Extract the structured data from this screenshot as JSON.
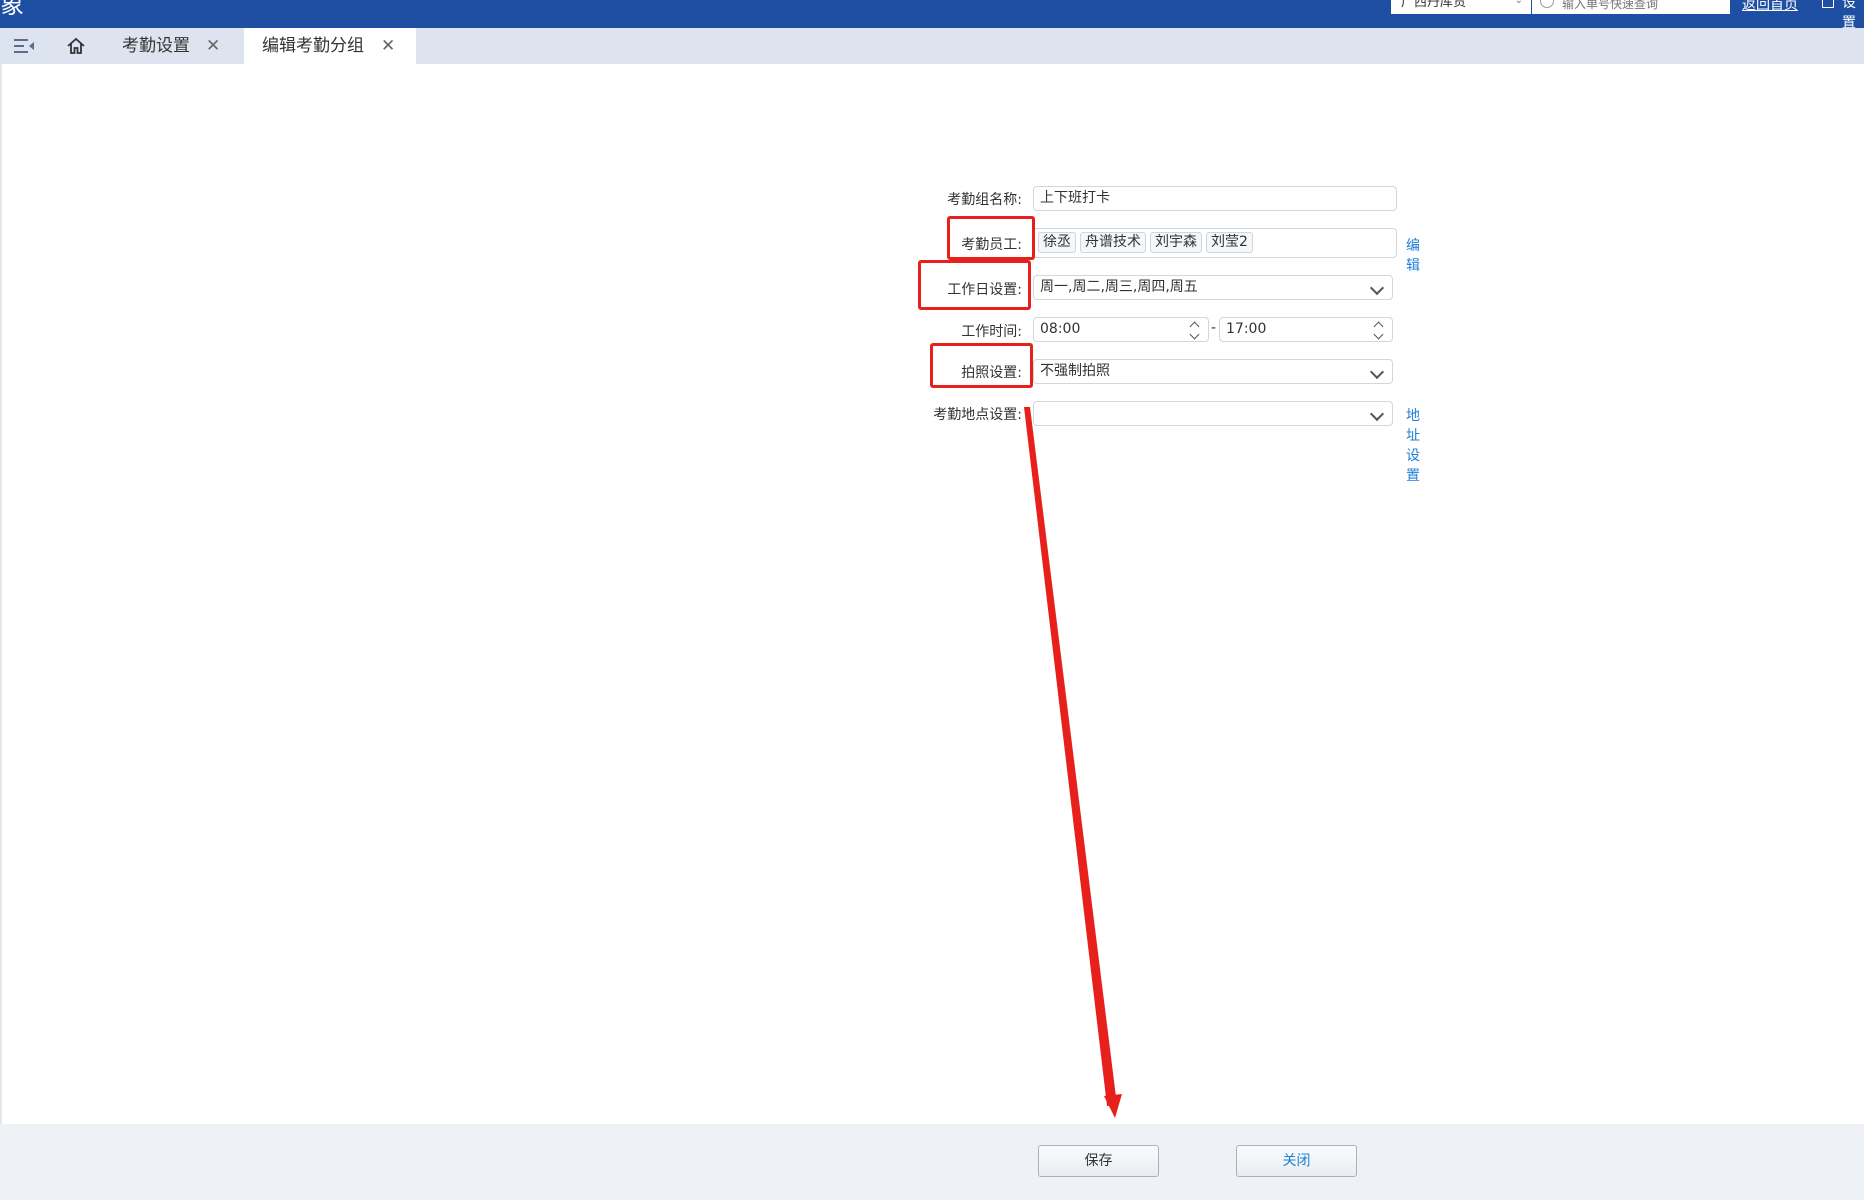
{
  "topbar": {
    "brand": "象",
    "company_select": "广西丹库货",
    "search_placeholder": "输入单号快速查询",
    "link": "返回首页",
    "user": "设置"
  },
  "tabs": [
    {
      "label": "考勤设置"
    },
    {
      "label": "编辑考勤分组"
    }
  ],
  "form": {
    "group_name": {
      "label": "考勤组名称:",
      "value": "上下班打卡"
    },
    "employees": {
      "label": "考勤员工:",
      "tags": [
        "徐丞",
        "舟谱技术",
        "刘宇森",
        "刘莹2"
      ],
      "edit_link": "编辑"
    },
    "workdays": {
      "label": "工作日设置:",
      "value": "周一,周二,周三,周四,周五"
    },
    "work_time": {
      "label": "工作时间:",
      "start": "08:00",
      "separator": "-",
      "end": "17:00"
    },
    "photo": {
      "label": "拍照设置:",
      "value": "不强制拍照"
    },
    "location": {
      "label": "考勤地点设置:",
      "value": "",
      "link": "地址设置"
    }
  },
  "footer": {
    "save": "保存",
    "close": "关闭"
  },
  "colors": {
    "header": "#1e4fa3",
    "tabstrip": "#dee4ef",
    "annotation": "#e8201c",
    "link": "#1f7fd6"
  }
}
